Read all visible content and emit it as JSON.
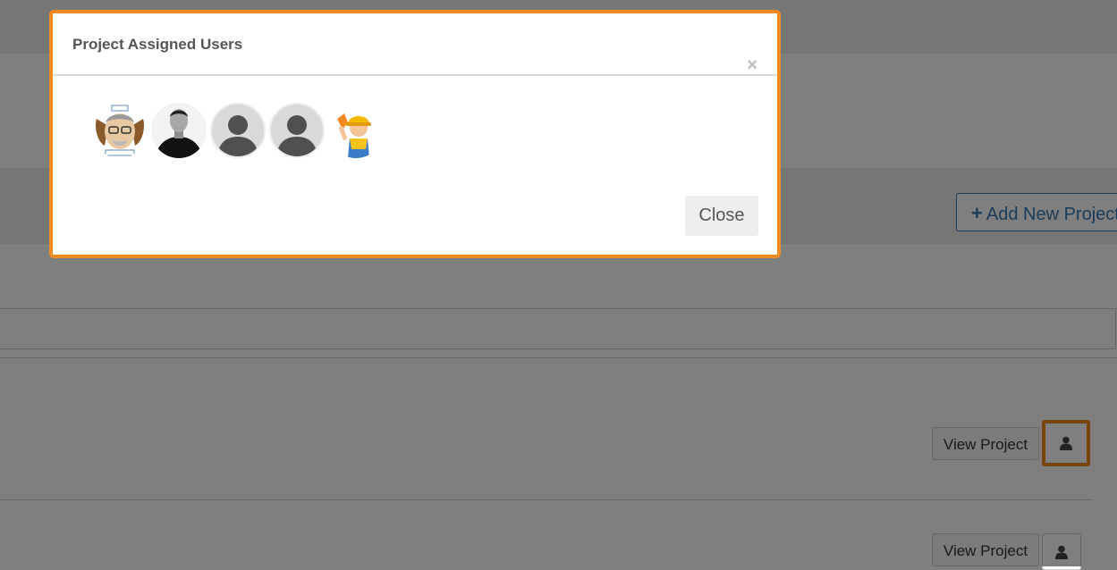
{
  "page": {
    "add_project_label": "Add New Project",
    "rows": [
      {
        "view_label": "View Project"
      },
      {
        "view_label": "View Project"
      }
    ]
  },
  "modal": {
    "title": "Project Assigned Users",
    "close_x": "×",
    "close_label": "Close",
    "users": [
      {
        "avatar": "cartoon-man-avatar"
      },
      {
        "avatar": "man-photo-avatar"
      },
      {
        "avatar": "default-user-avatar"
      },
      {
        "avatar": "default-user-avatar"
      },
      {
        "avatar": "construction-worker-avatar"
      }
    ]
  },
  "colors": {
    "highlight": "#f28a1f",
    "primary": "#337ab7",
    "overlay": "rgba(0,0,0,0.5)"
  }
}
